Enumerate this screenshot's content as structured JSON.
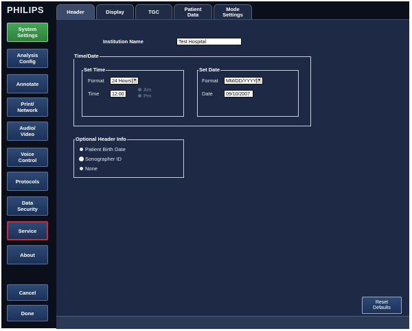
{
  "brand": "PHILIPS",
  "tabs": [
    {
      "label": "Header",
      "active": true
    },
    {
      "label": "Display",
      "active": false
    },
    {
      "label": "TGC",
      "active": false
    },
    {
      "label": "Patient\nData",
      "active": false
    },
    {
      "label": "Mode\nSettings",
      "active": false
    }
  ],
  "sidebar": {
    "items": [
      {
        "label": "System\nSettings",
        "state": "active"
      },
      {
        "label": "Analysis\nConfig",
        "state": "normal"
      },
      {
        "label": "Annotate",
        "state": "normal"
      },
      {
        "label": "Print/\nNetwork",
        "state": "normal"
      },
      {
        "label": "Audio/\nVideo",
        "state": "normal"
      },
      {
        "label": "Voice\nControl",
        "state": "normal"
      },
      {
        "label": "Protocols",
        "state": "normal"
      },
      {
        "label": "Data\nSecurity",
        "state": "normal"
      },
      {
        "label": "Service",
        "state": "selected"
      },
      {
        "label": "About",
        "state": "normal"
      }
    ],
    "cancel": "Cancel",
    "done": "Done"
  },
  "header": {
    "institution_label": "Institution Name",
    "institution_value": "Test Hospital",
    "time_date": {
      "title": "Time/Date",
      "set_time": {
        "title": "Set Time",
        "format_label": "Format",
        "format_value": "24 Hours",
        "time_label": "Time",
        "time_value": "12:00",
        "am": "Am",
        "pm": "Pm"
      },
      "set_date": {
        "title": "Set Date",
        "format_label": "Format",
        "format_value": "MM/DD/YYYY",
        "date_label": "Date",
        "date_value": "09/10/2007"
      }
    },
    "optional": {
      "title": "Optional Header Info",
      "options": [
        "Patient Birth Date",
        "Sonographer ID",
        "None"
      ],
      "selected": "Sonographer ID"
    }
  },
  "reset_defaults": "Reset\nDefaults"
}
